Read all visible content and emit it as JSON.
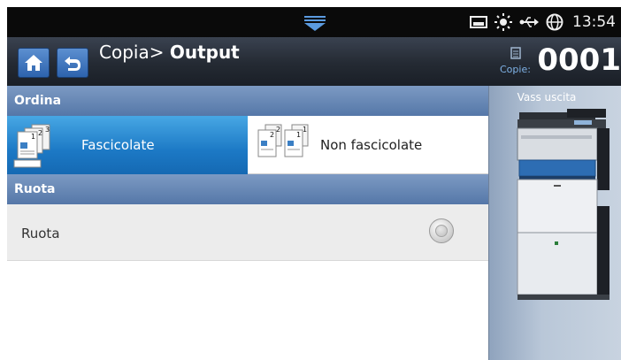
{
  "status_bar": {
    "time": "13:54",
    "icons": [
      "pull-down-handle-icon",
      "toner-icon",
      "brightness-icon",
      "usb-icon",
      "globe-icon"
    ]
  },
  "header": {
    "breadcrumb": "Copia>",
    "title": "Output",
    "copies_label": "Copie:",
    "copies_count": "0001",
    "icons": [
      "home-icon",
      "back-icon",
      "copies-icon"
    ]
  },
  "sections": {
    "collate": {
      "header": "Ordina",
      "options": [
        {
          "label": "Fascicolate",
          "selected": true
        },
        {
          "label": "Non fascicolate",
          "selected": false
        }
      ]
    },
    "rotate": {
      "header": "Ruota",
      "row_label": "Ruota",
      "checked": false
    }
  },
  "side_panel": {
    "title": "Vass uscita"
  },
  "colors": {
    "selected": "#1c79c5",
    "section_header": "#6484b2",
    "nav_button": "#3f75bf",
    "copies_label": "#7fb2e6"
  }
}
